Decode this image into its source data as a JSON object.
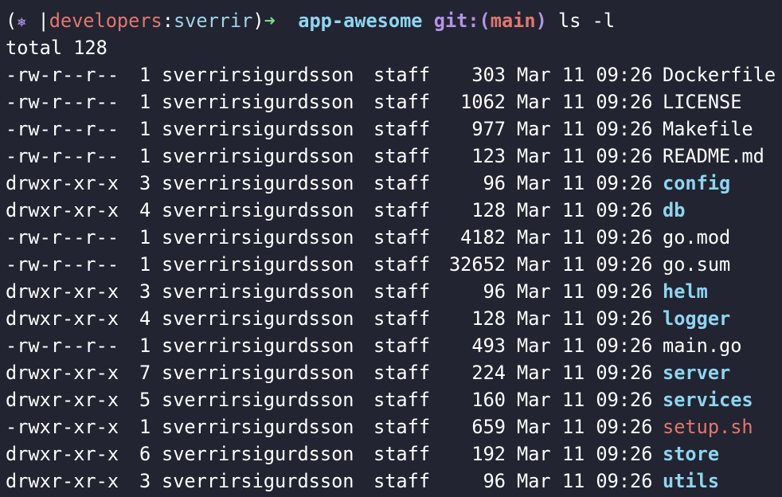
{
  "prompt": {
    "open_paren": "(",
    "icon": "⎈",
    "bar": " |",
    "user": "developers",
    "colon": ":",
    "context": "sverrir",
    "close_paren": ")",
    "arrow": "➜",
    "directory": "app-awesome",
    "git_label": "git:(",
    "branch": "main",
    "git_close": ")",
    "command": "ls -l"
  },
  "total_line": "total 128",
  "listing": [
    {
      "perm": "-rw-r--r--",
      "links": "1",
      "owner": "sverrirsigurdsson",
      "group": "staff",
      "size": "303",
      "date": "Mar 11 09:26",
      "name": "Dockerfile",
      "kind": "file"
    },
    {
      "perm": "-rw-r--r--",
      "links": "1",
      "owner": "sverrirsigurdsson",
      "group": "staff",
      "size": "1062",
      "date": "Mar 11 09:26",
      "name": "LICENSE",
      "kind": "file"
    },
    {
      "perm": "-rw-r--r--",
      "links": "1",
      "owner": "sverrirsigurdsson",
      "group": "staff",
      "size": "977",
      "date": "Mar 11 09:26",
      "name": "Makefile",
      "kind": "file"
    },
    {
      "perm": "-rw-r--r--",
      "links": "1",
      "owner": "sverrirsigurdsson",
      "group": "staff",
      "size": "123",
      "date": "Mar 11 09:26",
      "name": "README.md",
      "kind": "file"
    },
    {
      "perm": "drwxr-xr-x",
      "links": "3",
      "owner": "sverrirsigurdsson",
      "group": "staff",
      "size": "96",
      "date": "Mar 11 09:26",
      "name": "config",
      "kind": "dir"
    },
    {
      "perm": "drwxr-xr-x",
      "links": "4",
      "owner": "sverrirsigurdsson",
      "group": "staff",
      "size": "128",
      "date": "Mar 11 09:26",
      "name": "db",
      "kind": "dir"
    },
    {
      "perm": "-rw-r--r--",
      "links": "1",
      "owner": "sverrirsigurdsson",
      "group": "staff",
      "size": "4182",
      "date": "Mar 11 09:26",
      "name": "go.mod",
      "kind": "file"
    },
    {
      "perm": "-rw-r--r--",
      "links": "1",
      "owner": "sverrirsigurdsson",
      "group": "staff",
      "size": "32652",
      "date": "Mar 11 09:26",
      "name": "go.sum",
      "kind": "file"
    },
    {
      "perm": "drwxr-xr-x",
      "links": "3",
      "owner": "sverrirsigurdsson",
      "group": "staff",
      "size": "96",
      "date": "Mar 11 09:26",
      "name": "helm",
      "kind": "dir"
    },
    {
      "perm": "drwxr-xr-x",
      "links": "4",
      "owner": "sverrirsigurdsson",
      "group": "staff",
      "size": "128",
      "date": "Mar 11 09:26",
      "name": "logger",
      "kind": "dir"
    },
    {
      "perm": "-rw-r--r--",
      "links": "1",
      "owner": "sverrirsigurdsson",
      "group": "staff",
      "size": "493",
      "date": "Mar 11 09:26",
      "name": "main.go",
      "kind": "file"
    },
    {
      "perm": "drwxr-xr-x",
      "links": "7",
      "owner": "sverrirsigurdsson",
      "group": "staff",
      "size": "224",
      "date": "Mar 11 09:26",
      "name": "server",
      "kind": "dir"
    },
    {
      "perm": "drwxr-xr-x",
      "links": "5",
      "owner": "sverrirsigurdsson",
      "group": "staff",
      "size": "160",
      "date": "Mar 11 09:26",
      "name": "services",
      "kind": "dir"
    },
    {
      "perm": "-rwxr-xr-x",
      "links": "1",
      "owner": "sverrirsigurdsson",
      "group": "staff",
      "size": "659",
      "date": "Mar 11 09:26",
      "name": "setup.sh",
      "kind": "exec"
    },
    {
      "perm": "drwxr-xr-x",
      "links": "6",
      "owner": "sverrirsigurdsson",
      "group": "staff",
      "size": "192",
      "date": "Mar 11 09:26",
      "name": "store",
      "kind": "dir"
    },
    {
      "perm": "drwxr-xr-x",
      "links": "3",
      "owner": "sverrirsigurdsson",
      "group": "staff",
      "size": "96",
      "date": "Mar 11 09:26",
      "name": "utils",
      "kind": "dir"
    }
  ],
  "colors": {
    "background": "#222431",
    "directory": "#8fd5f0",
    "executable": "#e2776e",
    "file": "#ffffff",
    "prompt_arrow": "#7ed98a",
    "git": "#b393e6"
  }
}
